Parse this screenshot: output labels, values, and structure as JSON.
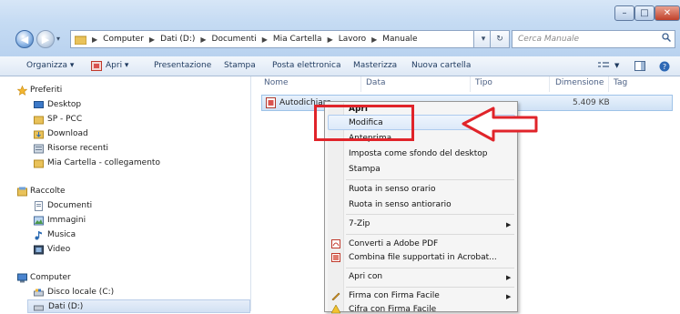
{
  "window": {
    "min": "–",
    "max": "□",
    "close": "✕"
  },
  "nav": {
    "back": "◀",
    "forward": "▶",
    "history": "▾"
  },
  "breadcrumb": [
    "Computer",
    "Dati (D:)",
    "Documenti",
    "Mia Cartella",
    "Lavoro",
    "Manuale"
  ],
  "address": {
    "dropdown": "▾",
    "refresh": "↻"
  },
  "search": {
    "placeholder": "Cerca Manuale"
  },
  "toolbar": {
    "organize": "Organizza ▾",
    "open": "Apri ▾",
    "presentation": "Presentazione",
    "print": "Stampa",
    "email": "Posta elettronica",
    "burn": "Masterizza",
    "new_folder": "Nuova cartella"
  },
  "sidebar": {
    "favorites": "Preferiti",
    "fav_items": [
      "Desktop",
      "SP - PCC",
      "Download",
      "Risorse recenti",
      "Mia Cartella - collegamento"
    ],
    "libraries": "Raccolte",
    "lib_items": [
      "Documenti",
      "Immagini",
      "Musica",
      "Video"
    ],
    "computer": "Computer",
    "comp_items": [
      "Disco locale (C:)",
      "Dati (D:)"
    ]
  },
  "columns": {
    "name": "Nome",
    "date": "Data",
    "type": "Tipo",
    "size": "Dimensione",
    "tag": "Tag"
  },
  "file": {
    "name": "Autodichiara",
    "size": "5.409 KB"
  },
  "context_menu": {
    "open": "Apri",
    "edit": "Modifica",
    "preview": "Anteprima",
    "set_desktop_bg": "Imposta come sfondo del desktop",
    "print": "Stampa",
    "rotate_cw": "Ruota in senso orario",
    "rotate_ccw": "Ruota in senso antiorario",
    "zip": "7-Zip",
    "convert_pdf": "Converti a Adobe PDF",
    "combine_acrobat": "Combina file supportati in Acrobat...",
    "open_with": "Apri con",
    "sign": "Firma con Firma Facile",
    "encrypt": "Cifra con Firma Facile"
  },
  "colors": {
    "annotation": "#e0242a",
    "selection": "#cfe1f5"
  }
}
